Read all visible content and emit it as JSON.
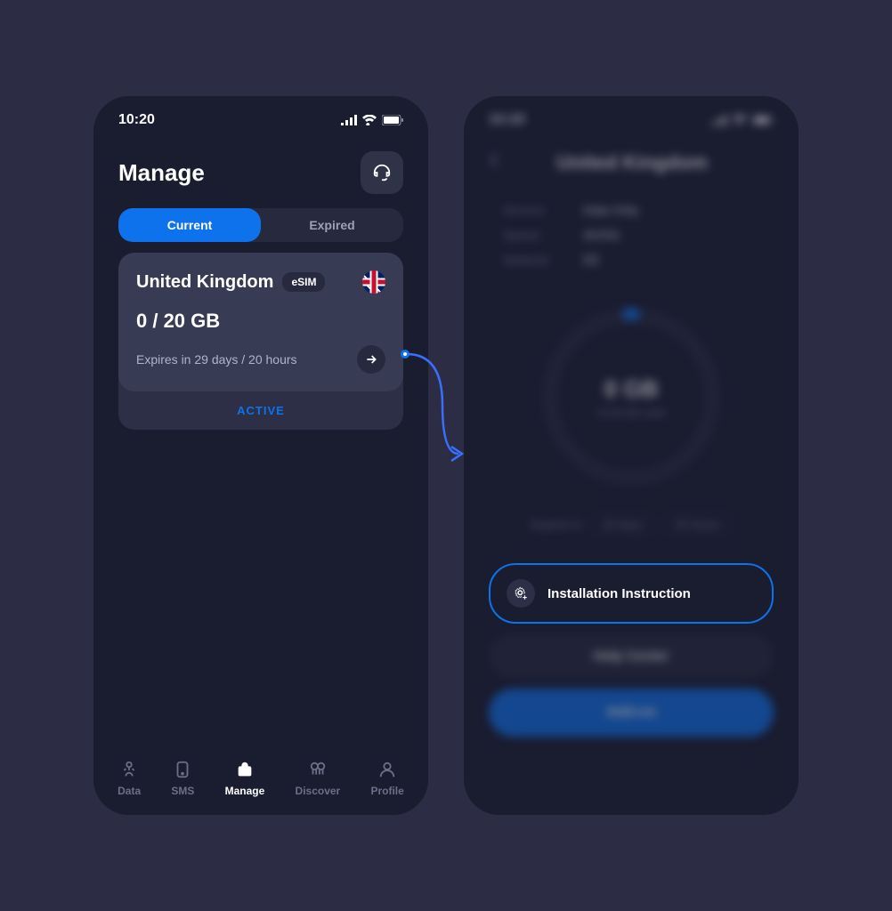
{
  "statusBar": {
    "time": "10:20"
  },
  "phone1": {
    "title": "Manage",
    "tabs": {
      "current": "Current",
      "expired": "Expired"
    },
    "card": {
      "country": "United Kingdom",
      "badge": "eSIM",
      "usage": "0 / 20 GB",
      "expires": "Expires in 29 days / 20 hours",
      "status": "ACTIVE"
    },
    "nav": {
      "data": "Data",
      "sms": "SMS",
      "manage": "Manage",
      "discover": "Discover",
      "profile": "Profile"
    }
  },
  "phone2": {
    "title": "United Kingdom",
    "info": {
      "service": {
        "label": "Service",
        "value": "Data Only"
      },
      "speed": {
        "label": "Speed",
        "value": "4G/5G"
      },
      "network": {
        "label": "Network",
        "value": "EE"
      }
    },
    "gauge": {
      "main": "0 GB",
      "sub": "of 20 GB used"
    },
    "expires": {
      "label": "Expires in",
      "days": "29 days",
      "hours": "20 hours"
    },
    "actions": {
      "install": "Installation Instruction",
      "help": "Help Center",
      "addon": "Add-on"
    }
  }
}
